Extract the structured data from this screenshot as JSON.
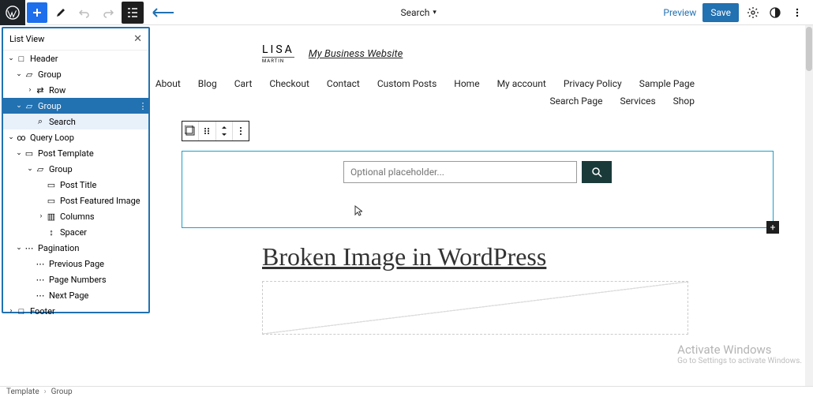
{
  "toolbar": {
    "center_label": "Search",
    "preview": "Preview",
    "save": "Save"
  },
  "listview": {
    "title": "List View",
    "items": [
      {
        "label": "Header",
        "depth": 0,
        "toggle": "v",
        "icon": "□",
        "selected": false
      },
      {
        "label": "Group",
        "depth": 1,
        "toggle": "v",
        "icon": "▱",
        "selected": false
      },
      {
        "label": "Row",
        "depth": 2,
        "toggle": ">",
        "icon": "⇄",
        "selected": false
      },
      {
        "label": "Group",
        "depth": 1,
        "toggle": "v",
        "icon": "▱",
        "selected": true
      },
      {
        "label": "Search",
        "depth": 2,
        "toggle": "",
        "icon": "⌕",
        "selected": false,
        "highlighted": true
      },
      {
        "label": "Query Loop",
        "depth": 0,
        "toggle": "v",
        "icon": "∞",
        "selected": false
      },
      {
        "label": "Post Template",
        "depth": 1,
        "toggle": "v",
        "icon": "▭",
        "selected": false
      },
      {
        "label": "Group",
        "depth": 2,
        "toggle": "v",
        "icon": "▱",
        "selected": false
      },
      {
        "label": "Post Title",
        "depth": 3,
        "toggle": "",
        "icon": "▭",
        "selected": false
      },
      {
        "label": "Post Featured Image",
        "depth": 3,
        "toggle": "",
        "icon": "▭",
        "selected": false
      },
      {
        "label": "Columns",
        "depth": 3,
        "toggle": ">",
        "icon": "▥",
        "selected": false
      },
      {
        "label": "Spacer",
        "depth": 3,
        "toggle": "",
        "icon": "↕",
        "selected": false
      },
      {
        "label": "Pagination",
        "depth": 1,
        "toggle": "v",
        "icon": "⋯",
        "selected": false
      },
      {
        "label": "Previous Page",
        "depth": 2,
        "toggle": "",
        "icon": "⋯",
        "selected": false
      },
      {
        "label": "Page Numbers",
        "depth": 2,
        "toggle": "",
        "icon": "⋯",
        "selected": false
      },
      {
        "label": "Next Page",
        "depth": 2,
        "toggle": "",
        "icon": "⋯",
        "selected": false
      },
      {
        "label": "Footer",
        "depth": 0,
        "toggle": ">",
        "icon": "□",
        "selected": false
      }
    ]
  },
  "site": {
    "logo_main": "LISA",
    "logo_sub": "MARTIN",
    "title": "My Business Website"
  },
  "nav": [
    "About",
    "Blog",
    "Cart",
    "Checkout",
    "Contact",
    "Custom Posts",
    "Home",
    "My account",
    "Privacy Policy",
    "Sample Page"
  ],
  "nav2": [
    "Search Page",
    "Services",
    "Shop"
  ],
  "search": {
    "placeholder": "Optional placeholder..."
  },
  "post": {
    "title": "Broken Image in WordPress"
  },
  "watermark": {
    "line1": "Activate Windows",
    "line2": "Go to Settings to activate Windows."
  },
  "breadcrumb": {
    "item1": "Template",
    "item2": "Group"
  }
}
